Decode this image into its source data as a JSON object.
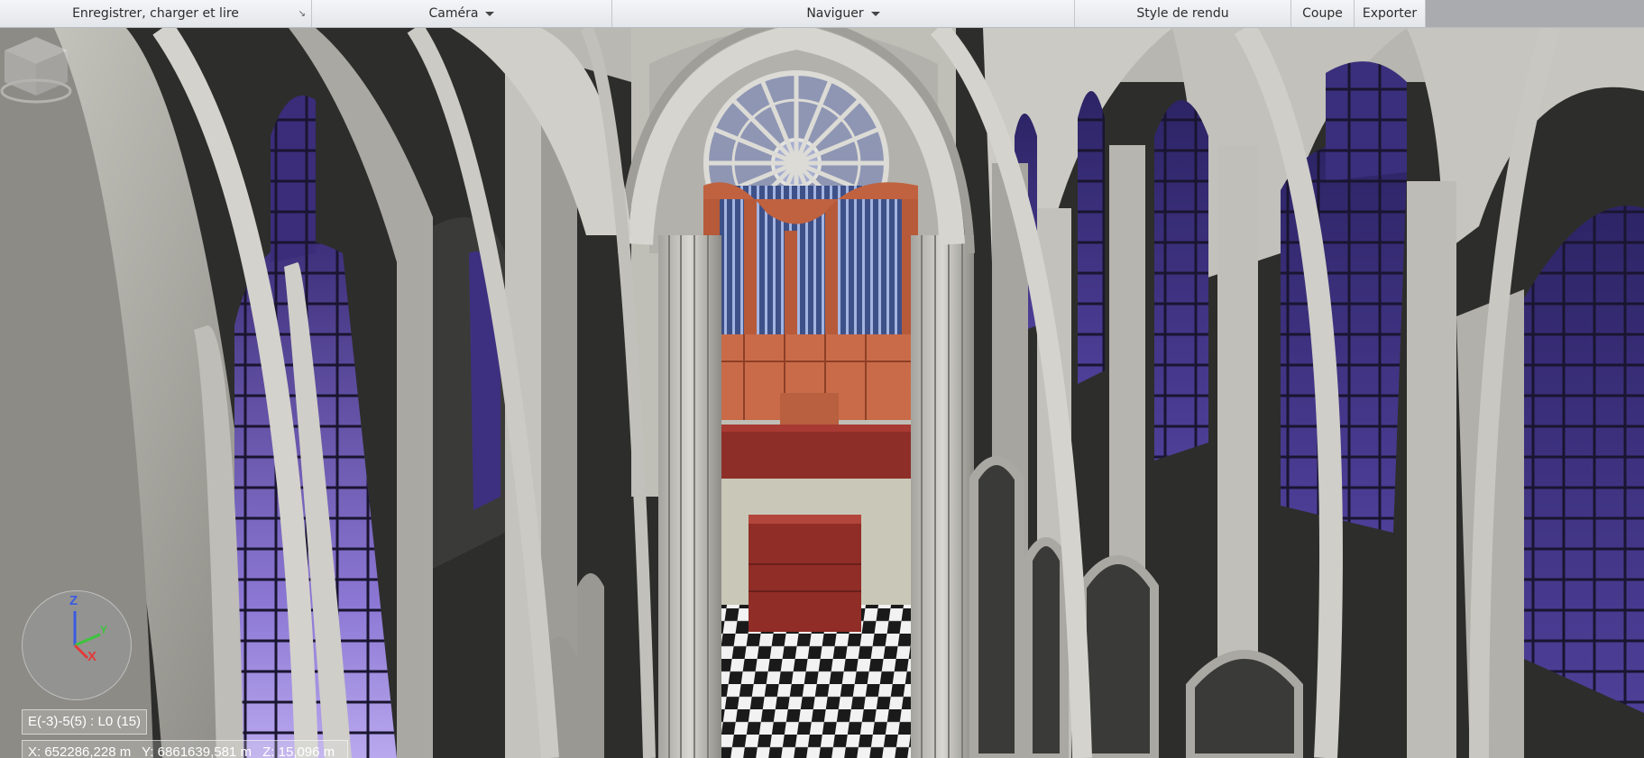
{
  "ribbon": {
    "panels": [
      {
        "label": "Enregistrer, charger et lire"
      },
      {
        "label": "Caméra"
      },
      {
        "label": "Naviguer"
      },
      {
        "label": "Style de rendu"
      },
      {
        "label": "Coupe"
      },
      {
        "label": "Exporter"
      }
    ]
  },
  "overlay": {
    "axes": {
      "z": "Z",
      "y": "Y",
      "x": "X"
    },
    "level": "E(-3)-5(5) : L0 (15)",
    "coords": {
      "x": "X: 652286,228 m",
      "y": "Y: 6861639,581 m",
      "z": "Z: 15,096 m"
    }
  },
  "icons": {
    "dropdown": "chevron-down-icon",
    "launcher": "dialog-launcher-icon",
    "viewcube": "viewcube-icon",
    "tripod": "axis-tripod-icon"
  },
  "colors": {
    "stone": "#c9c8c2",
    "stone_dark": "#8f8e88",
    "shadow": "#2c2c2a",
    "glass": "#5b4a9c",
    "glass_light": "#9a86d6",
    "organ_wood": "#c0623f",
    "organ_pipes": "#4a5c8e",
    "axis_x": "#e23a3a",
    "axis_y": "#3cc43c",
    "axis_z": "#3a5be2"
  }
}
